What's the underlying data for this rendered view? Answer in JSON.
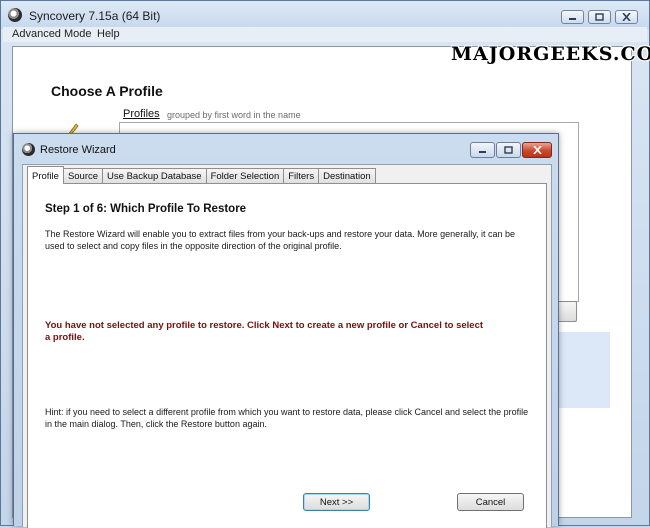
{
  "main_window": {
    "title": "Syncovery 7.15a (64 Bit)",
    "menu": [
      {
        "label": "Advanced Mode"
      },
      {
        "label": "Help"
      }
    ],
    "watermark": "MAJORGEEKS.COM",
    "page_title": "Choose A Profile",
    "profiles_label": "Profiles",
    "profiles_hint": "grouped by first word in the name"
  },
  "dialog": {
    "title": "Restore Wizard",
    "tabs": [
      {
        "label": "Profile",
        "active": true
      },
      {
        "label": "Source"
      },
      {
        "label": "Use Backup Database"
      },
      {
        "label": "Folder Selection"
      },
      {
        "label": "Filters"
      },
      {
        "label": "Destination"
      }
    ],
    "step_title": "Step 1 of 6: Which Profile To Restore",
    "description": "The Restore Wizard will enable you to extract files from your back-ups and restore your data. More generally, it can be used to select and copy files in the opposite direction of the original profile.",
    "warning": "You have not selected any profile to restore. Click Next to create a new profile or Cancel to select a profile.",
    "hint": "Hint: if you need to select a different profile from which you want to restore data, please click Cancel and select the profile in the main dialog. Then, click the Restore button again.",
    "next_label": "Next >>",
    "cancel_label": "Cancel"
  },
  "colors": {
    "warning_text": "#7a0e0e",
    "close_button": "#c9482f"
  },
  "icons": [
    "app-icon",
    "minimize-icon",
    "maximize-icon",
    "close-icon",
    "pencil-icon"
  ]
}
